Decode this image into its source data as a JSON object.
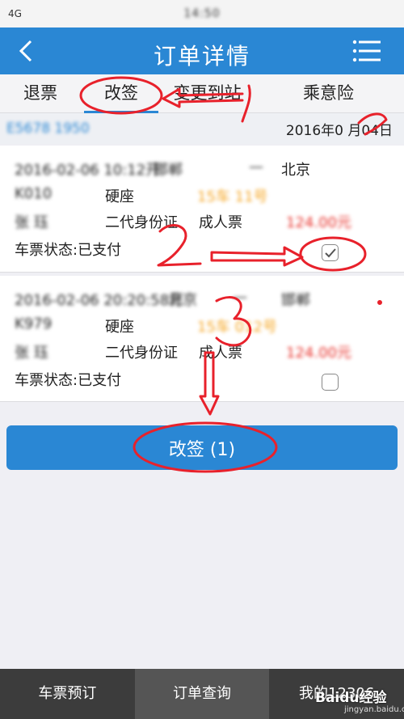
{
  "status_bar": {
    "time": "14:50",
    "signal": "4G"
  },
  "header": {
    "title": "订单详情",
    "back_icon": "chevron-left-icon",
    "menu_icon": "menu-icon"
  },
  "tabs": [
    {
      "label": "退票"
    },
    {
      "label": "改签",
      "active": true
    },
    {
      "label": "变更到站"
    },
    {
      "label": "乘意险"
    }
  ],
  "order": {
    "number": "E5678 1950",
    "date": "2016年0 月04日"
  },
  "tickets": [
    {
      "departure": "2016-02-06 10:12开",
      "from": "邯郸",
      "arrow": "—",
      "to": "北京",
      "train": "K010",
      "seat_type": "硬座",
      "seat_no": "15车  11号",
      "passenger": "张 珏",
      "id_type": "二代身份证",
      "ticket_type": "成人票",
      "price": "124.00元",
      "status": "车票状态:已支付",
      "checked": true
    },
    {
      "departure": "2016-02-06 20:20:58开",
      "from": "北京",
      "arrow": "—",
      "to": "邯郸",
      "train": "K979",
      "seat_type": "硬座",
      "seat_no": "15车  012号",
      "passenger": "张 珏",
      "id_type": "二代身份证",
      "ticket_type": "成人票",
      "price": "124.00元",
      "status": "车票状态:已支付",
      "checked": false
    }
  ],
  "action_button": {
    "label": "改签 (1)"
  },
  "bottom_nav": [
    {
      "label": "车票预订"
    },
    {
      "label": "订单查询",
      "active": true
    },
    {
      "label": "我的12306"
    }
  ],
  "annotations": {
    "mark1": "1",
    "mark2": "2",
    "mark3": "3"
  },
  "watermark": {
    "brand": "Baidu经验",
    "url": "jingyan.baidu.com"
  },
  "colors": {
    "primary": "#2a87d4",
    "price_red": "#e8312b",
    "seat_orange": "#f5a623",
    "annotation_red": "#e8212b"
  }
}
